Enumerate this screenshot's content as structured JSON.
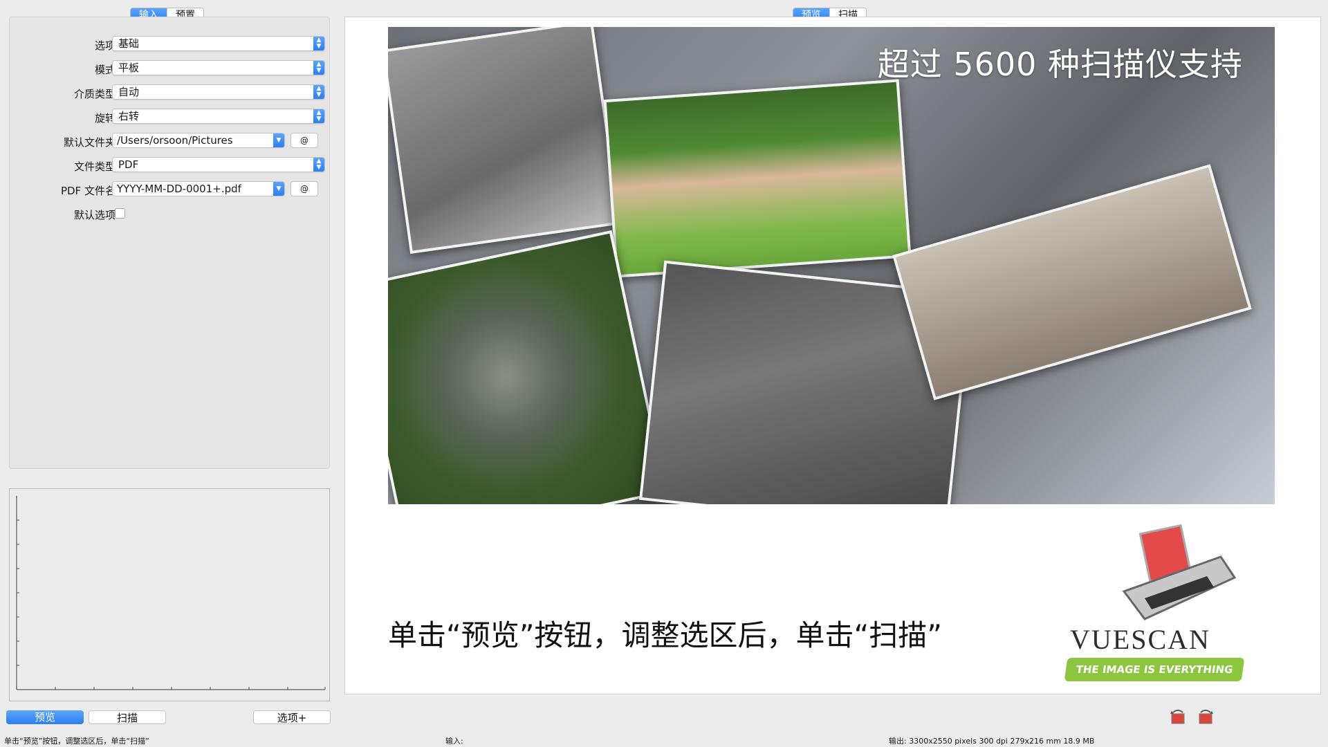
{
  "left_tabs": {
    "input": "输入",
    "preset": "预置"
  },
  "right_tabs": {
    "preview": "预览",
    "scan": "扫描"
  },
  "form": {
    "option_label": "选项:",
    "option_value": "基础",
    "mode_label": "模式:",
    "mode_value": "平板",
    "media_label": "介质类型:",
    "media_value": "自动",
    "rotate_label": "旋转:",
    "rotate_value": "右转",
    "folder_label": "默认文件夹:",
    "folder_value": "/Users/orsoon/Pictures",
    "filetype_label": "文件类型:",
    "filetype_value": "PDF",
    "pdfname_label": "PDF 文件名:",
    "pdfname_value": "YYYY-MM-DD-0001+.pdf",
    "default_label": "默认选项:",
    "at_symbol": "@"
  },
  "buttons": {
    "preview": "预览",
    "scan": "扫描",
    "options": "选项+"
  },
  "preview_image": {
    "headline": "超过 5600 种扫描仪支持",
    "caption": "单击“预览”按钮，调整选区后，单击“扫描”",
    "logo_name": "VUESCAN",
    "logo_tagline": "THE IMAGE IS EVERYTHING"
  },
  "status": {
    "left": "单击“预览”按钮，调整选区后，单击“扫描”",
    "middle": "输入:",
    "right": "输出: 3300x2550 pixels 300 dpi 279x216 mm 18.9 MB"
  },
  "icons": {
    "rotate_left": "rotate-left-icon",
    "rotate_right": "rotate-right-icon"
  },
  "colors": {
    "accent": "#2c7ff0",
    "logo_green": "#8cc63f"
  }
}
